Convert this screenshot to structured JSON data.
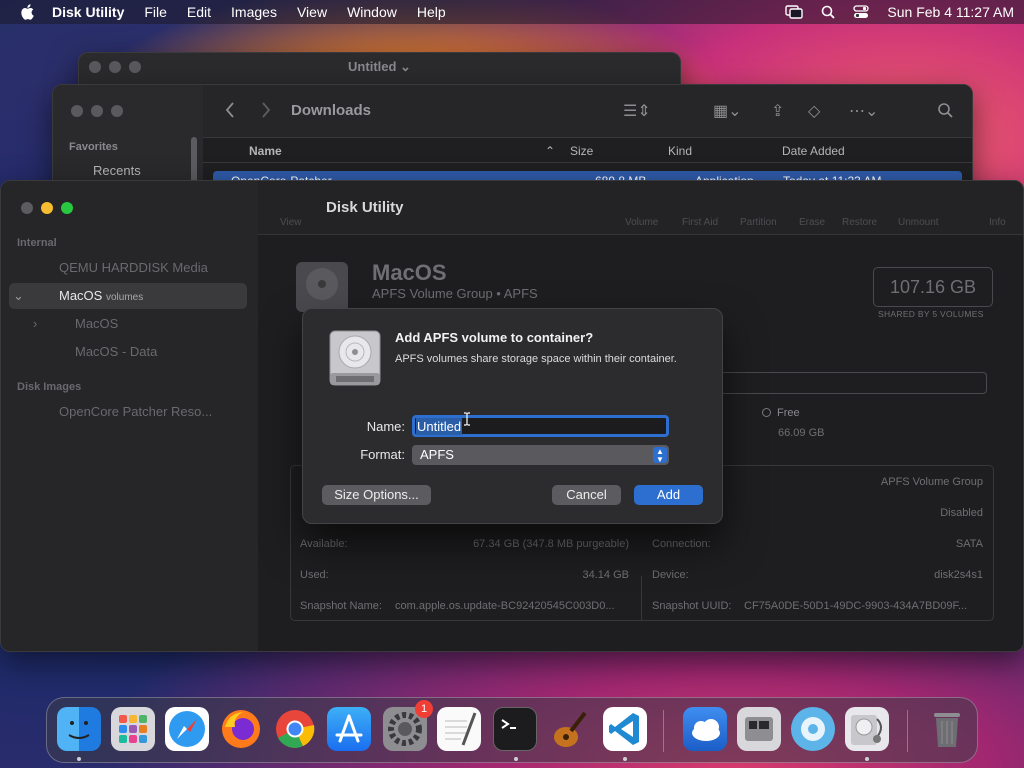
{
  "menubar": {
    "app": "Disk Utility",
    "items": [
      "File",
      "Edit",
      "Images",
      "View",
      "Window",
      "Help"
    ],
    "datetime": "Sun Feb 4  11:27 AM"
  },
  "untitled_window": {
    "title": "Untitled ⌄"
  },
  "finder": {
    "location": "Downloads",
    "sidebar_section": "Favorites",
    "sidebar_item": "Recents",
    "columns": {
      "name": "Name",
      "size": "Size",
      "kind": "Kind",
      "date": "Date Added"
    },
    "row": {
      "name": "OpenCore-Patcher",
      "size": "689.8 MB",
      "kind": "Application",
      "date": "Today at 11:23 AM"
    }
  },
  "disk_utility": {
    "title": "Disk Utility",
    "toolbar": {
      "view": "View",
      "volume": "Volume",
      "first_aid": "First Aid",
      "partition": "Partition",
      "erase": "Erase",
      "restore": "Restore",
      "unmount": "Unmount",
      "info": "Info"
    },
    "sidebar": {
      "internal": "Internal",
      "hdd": "QEMU HARDDISK Media",
      "macos": "MacOS",
      "volumes": "volumes",
      "macos_sub": "MacOS",
      "macos_data": "MacOS - Data",
      "disk_images": "Disk Images",
      "opencore": "OpenCore Patcher Reso..."
    },
    "volume": {
      "name": "MacOS",
      "subtitle": "APFS Volume Group • APFS",
      "size": "107.16 GB",
      "shared": "SHARED BY 5 VOLUMES",
      "free_label": "Free",
      "free_value": "66.09 GB",
      "info": {
        "type_value": "APFS Volume Group",
        "owners_value": "Disabled",
        "available_label": "Available:",
        "available_value": "67.34 GB (347.8 MB purgeable)",
        "used_label": "Used:",
        "used_value": "34.14 GB",
        "snapshot_label": "Snapshot Name:",
        "snapshot_value": "com.apple.os.update-BC92420545C003D0...",
        "connection_label": "Connection:",
        "connection_value": "SATA",
        "device_label": "Device:",
        "device_value": "disk2s4s1",
        "uuid_label": "Snapshot UUID:",
        "uuid_value": "CF75A0DE-50D1-49DC-9903-434A7BD09F..."
      }
    }
  },
  "dialog": {
    "heading": "Add APFS volume to container?",
    "message": "APFS volumes share storage space within their container.",
    "name_label": "Name:",
    "name_value": "Untitled",
    "format_label": "Format:",
    "format_value": "APFS",
    "size_options": "Size Options...",
    "cancel": "Cancel",
    "add": "Add"
  },
  "dock": {
    "apps": [
      "Finder",
      "Launchpad",
      "Safari",
      "Firefox",
      "Chrome",
      "App Store",
      "System Settings",
      "TextEdit",
      "Terminal",
      "GarageBand",
      "Visual Studio Code",
      "Weather",
      "Boot Camp Assistant",
      "Disk Image Mounter",
      "Disk Utility",
      "Trash"
    ],
    "settings_badge": "1"
  }
}
